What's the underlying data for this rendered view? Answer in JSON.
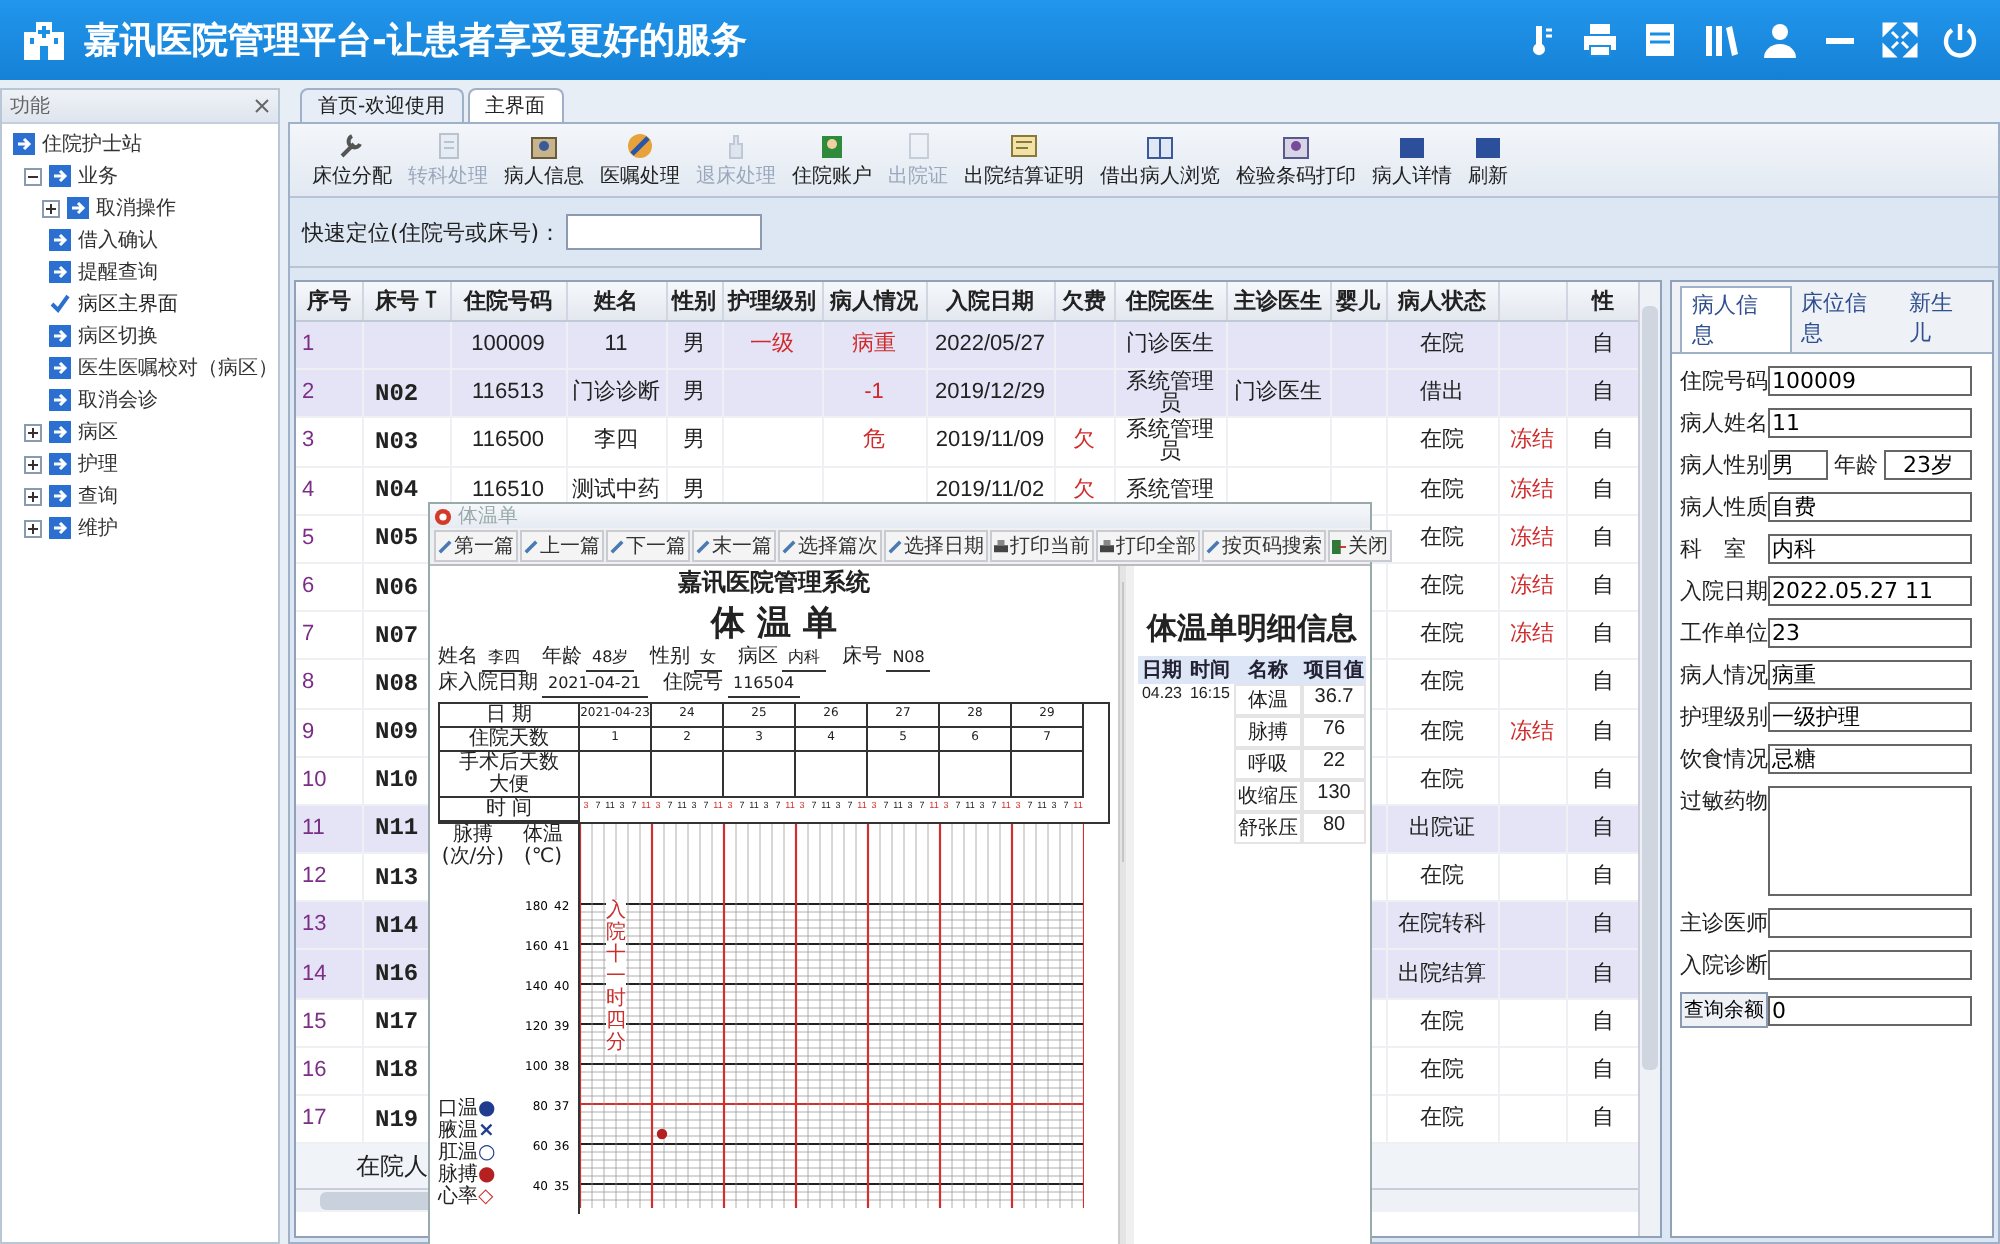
{
  "header": {
    "title": "嘉讯医院管理平台-让患者享受更好的服务"
  },
  "sidebar": {
    "title": "功能",
    "tree": [
      {
        "label": "住院护士站",
        "selected": false,
        "children": [
          {
            "label": "业务",
            "expanded": true,
            "selected": false,
            "children": [
              {
                "label": "取消操作",
                "expanded": false,
                "selected": false
              },
              {
                "label": "借入确认",
                "selected": false
              },
              {
                "label": "提醒查询",
                "selected": false
              },
              {
                "label": "病区主界面",
                "selected": true
              },
              {
                "label": "病区切换",
                "selected": false
              },
              {
                "label": "医生医嘱校对（病区）",
                "selected": false
              },
              {
                "label": "取消会诊",
                "selected": false
              }
            ]
          },
          {
            "label": "病区",
            "expanded": false,
            "selected": false
          },
          {
            "label": "护理",
            "expanded": false,
            "selected": false
          },
          {
            "label": "查询",
            "expanded": false,
            "selected": false
          },
          {
            "label": "维护",
            "expanded": false,
            "selected": false
          }
        ]
      }
    ]
  },
  "tabs": [
    {
      "label": "首页-欢迎使用",
      "selected": false
    },
    {
      "label": "主界面",
      "selected": true
    }
  ],
  "toolbar": [
    {
      "label": "床位分配",
      "disabled": false
    },
    {
      "label": "转科处理",
      "disabled": true
    },
    {
      "label": "病人信息",
      "disabled": false
    },
    {
      "label": "医嘱处理",
      "disabled": false
    },
    {
      "label": "退床处理",
      "disabled": true
    },
    {
      "label": "住院账户",
      "disabled": false
    },
    {
      "label": "出院证",
      "disabled": true
    },
    {
      "label": "出院结算证明",
      "disabled": false
    },
    {
      "label": "借出病人浏览",
      "disabled": false
    },
    {
      "label": "检验条码打印",
      "disabled": false
    },
    {
      "label": "病人详情",
      "disabled": false
    },
    {
      "label": "刷新",
      "disabled": false
    }
  ],
  "quick_search": {
    "label": "快速定位(住院号或床号)："
  },
  "table": {
    "columns": [
      {
        "label": "序号"
      },
      {
        "label": "床号",
        "sorted": true
      },
      {
        "label": "住院号码"
      },
      {
        "label": "姓名"
      },
      {
        "label": "性别"
      },
      {
        "label": "护理级别"
      },
      {
        "label": "病人情况"
      },
      {
        "label": "入院日期"
      },
      {
        "label": "欠费"
      },
      {
        "label": "住院医生"
      },
      {
        "label": "主诊医生"
      },
      {
        "label": "婴儿"
      },
      {
        "label": "病人状态"
      },
      {
        "label": "性"
      }
    ],
    "rows": [
      {
        "selected": true,
        "seq": "1",
        "admission_no": "100009",
        "name": "11",
        "sex": "男",
        "care_level": "一级",
        "condition": "病重",
        "admit_date": "2022/05/27",
        "ward_doctor": "门诊医生",
        "status": "在院",
        "column_15": "自"
      },
      {
        "selected": true,
        "seq": "2",
        "bed": "N02",
        "admission_no": "116513",
        "name": "门诊诊断",
        "sex": "男",
        "condition": "-1",
        "admit_date": "2019/12/29",
        "ward_doctor": "系统管理员",
        "chief_doctor": "门诊医生",
        "status": "借出",
        "column_15": "自"
      },
      {
        "selected": false,
        "seq": "3",
        "bed": "N03",
        "admission_no": "116500",
        "name": "李四",
        "sex": "男",
        "condition": "危",
        "admit_date": "2019/11/09",
        "arrears": "欠",
        "ward_doctor": "系统管理员",
        "status": "在院",
        "column_14": "冻结",
        "column_15": "自"
      },
      {
        "selected": false,
        "seq": "4",
        "bed": "N04",
        "admission_no": "116510",
        "name": "测试中药",
        "sex": "男",
        "admit_date": "2019/11/02",
        "arrears": "欠",
        "ward_doctor": "系统管理",
        "status": "在院",
        "column_14": "冻结",
        "column_15": "自"
      },
      {
        "selected": false,
        "seq": "5",
        "bed": "N05",
        "status": "在院",
        "column_14": "冻结",
        "column_15": "自"
      },
      {
        "selected": false,
        "seq": "6",
        "bed": "N06",
        "status": "在院",
        "column_14": "冻结",
        "column_15": "自"
      },
      {
        "selected": false,
        "seq": "7",
        "bed": "N07",
        "status": "在院",
        "column_14": "冻结",
        "column_15": "自"
      },
      {
        "selected": false,
        "seq": "8",
        "bed": "N08",
        "status": "在院",
        "column_15": "自"
      },
      {
        "selected": false,
        "seq": "9",
        "bed": "N09",
        "status": "在院",
        "column_14": "冻结",
        "column_15": "自"
      },
      {
        "selected": false,
        "seq": "10",
        "bed": "N10",
        "status": "在院",
        "column_15": "自"
      },
      {
        "selected": true,
        "seq": "11",
        "bed": "N11",
        "status": "出院证",
        "column_15": "自"
      },
      {
        "selected": false,
        "seq": "12",
        "bed": "N13",
        "status": "在院",
        "column_15": "自"
      },
      {
        "selected": true,
        "seq": "13",
        "bed": "N14",
        "status": "在院转科",
        "column_15": "自"
      },
      {
        "selected": true,
        "seq": "14",
        "bed": "N16",
        "status": "出院结算",
        "column_15": "自"
      },
      {
        "selected": false,
        "seq": "15",
        "bed": "N17",
        "status": "在院",
        "column_15": "自"
      },
      {
        "selected": false,
        "seq": "16",
        "bed": "N18",
        "status": "在院",
        "column_15": "自"
      },
      {
        "selected": false,
        "seq": "17",
        "bed": "N19",
        "status": "在院",
        "column_15": "自"
      }
    ],
    "footer": "在院人"
  },
  "patient_panel": {
    "tabs": [
      {
        "label": "病人信息",
        "selected": true
      },
      {
        "label": "床位信息",
        "selected": false
      },
      {
        "label": "新生儿",
        "selected": false
      }
    ],
    "fields": [
      {
        "kind": "text",
        "label": "住院号码",
        "value": "100009"
      },
      {
        "kind": "text",
        "label": "病人姓名",
        "value": "11"
      },
      {
        "kind": "pair",
        "label": "病人性别",
        "value": "男",
        "label2": "年龄",
        "value2": "23岁"
      },
      {
        "kind": "text",
        "label": "病人性质",
        "value": "自费"
      },
      {
        "kind": "text",
        "label": "科　室",
        "value": "内科"
      },
      {
        "kind": "text",
        "label": "入院日期",
        "value": "2022.05.27 11"
      },
      {
        "kind": "text",
        "label": "工作单位",
        "value": "23"
      },
      {
        "kind": "text",
        "label": "病人情况",
        "value": "病重"
      },
      {
        "kind": "text",
        "label": "护理级别",
        "value": "一级护理"
      },
      {
        "kind": "text",
        "label": "饮食情况",
        "value": "忌糖"
      },
      {
        "kind": "area",
        "label": "过敏药物"
      },
      {
        "kind": "text",
        "label": "主诊医师"
      },
      {
        "kind": "text",
        "label": "入院诊断"
      },
      {
        "kind": "button",
        "label": "查询余额",
        "value": "0"
      }
    ]
  },
  "temperature_window": {
    "title": "体温单",
    "buttons": [
      "第一篇",
      "上一篇",
      "下一篇",
      "末一篇",
      "选择篇次",
      "选择日期",
      "打印当前",
      "打印全部",
      "按页码搜索",
      "关闭"
    ],
    "sheet": {
      "org": "嘉讯医院管理系统",
      "title": "体 温 单",
      "info": [
        {
          "label": "姓名",
          "value": "李四"
        },
        {
          "label": "年龄",
          "value": "48岁"
        },
        {
          "label": "性别",
          "value": "女"
        },
        {
          "label": "病区",
          "value": "内科"
        },
        {
          "label": "床号",
          "value": "N08"
        },
        {
          "label": "床入院日期",
          "value": "2021-04-21"
        },
        {
          "label": "住院号",
          "value": "116504"
        }
      ],
      "row_labels": {
        "date": "日 期",
        "days": "住院天数",
        "surgery": "手术后天数",
        "stool": "大便",
        "time": "时 间"
      },
      "days": [
        {
          "date": "2021-04-23",
          "day_no": "1",
          "times": [
            "3",
            "7",
            "11",
            "3",
            "7",
            "11"
          ]
        },
        {
          "date": "24",
          "day_no": "2",
          "times": [
            "3",
            "7",
            "11",
            "3",
            "7",
            "11"
          ]
        },
        {
          "date": "25",
          "day_no": "3",
          "times": [
            "3",
            "7",
            "11",
            "3",
            "7",
            "11"
          ]
        },
        {
          "date": "26",
          "day_no": "4",
          "times": [
            "3",
            "7",
            "11",
            "3",
            "7",
            "11"
          ]
        },
        {
          "date": "27",
          "day_no": "5",
          "times": [
            "3",
            "7",
            "11",
            "3",
            "7",
            "11"
          ]
        },
        {
          "date": "28",
          "day_no": "6",
          "times": [
            "3",
            "7",
            "11",
            "3",
            "7",
            "11"
          ]
        },
        {
          "date": "29",
          "day_no": "7",
          "times": [
            "3",
            "7",
            "11",
            "3",
            "7",
            "11"
          ]
        }
      ],
      "pulse_label": "脉搏(次/分)",
      "temp_label": "体温(℃)",
      "ticks": [
        {
          "pulse": "180",
          "temp": "42"
        },
        {
          "pulse": "160",
          "temp": "41"
        },
        {
          "pulse": "140",
          "temp": "40"
        },
        {
          "pulse": "120",
          "temp": "39"
        },
        {
          "pulse": "100",
          "temp": "38"
        },
        {
          "pulse": "80",
          "temp": "37"
        },
        {
          "pulse": "60",
          "temp": "36"
        },
        {
          "pulse": "40",
          "temp": "35"
        }
      ],
      "note": "入院十一时四分",
      "legend": [
        {
          "label": "口温",
          "symbol": "●",
          "color": "#1f3c8f"
        },
        {
          "label": "腋温",
          "symbol": "×",
          "color": "#1f3c8f"
        },
        {
          "label": "肛温",
          "symbol": "○",
          "color": "#1f3c8f"
        },
        {
          "label": "脉搏",
          "symbol": "●",
          "color": "#b52020"
        },
        {
          "label": "心率",
          "symbol": "◇",
          "color": "#d03030"
        }
      ]
    },
    "details": {
      "title": "体温单明细信息",
      "columns": [
        "日期",
        "时间",
        "名称",
        "项目值"
      ],
      "rows": [
        {
          "date": "04.23",
          "time": "16:15",
          "name": "体温",
          "value": "36.7"
        },
        {
          "name": "脉搏",
          "value": "76"
        },
        {
          "name": "呼吸",
          "value": "22"
        },
        {
          "name": "收缩压",
          "value": "130"
        },
        {
          "name": "舒张压",
          "value": "80"
        }
      ]
    }
  }
}
